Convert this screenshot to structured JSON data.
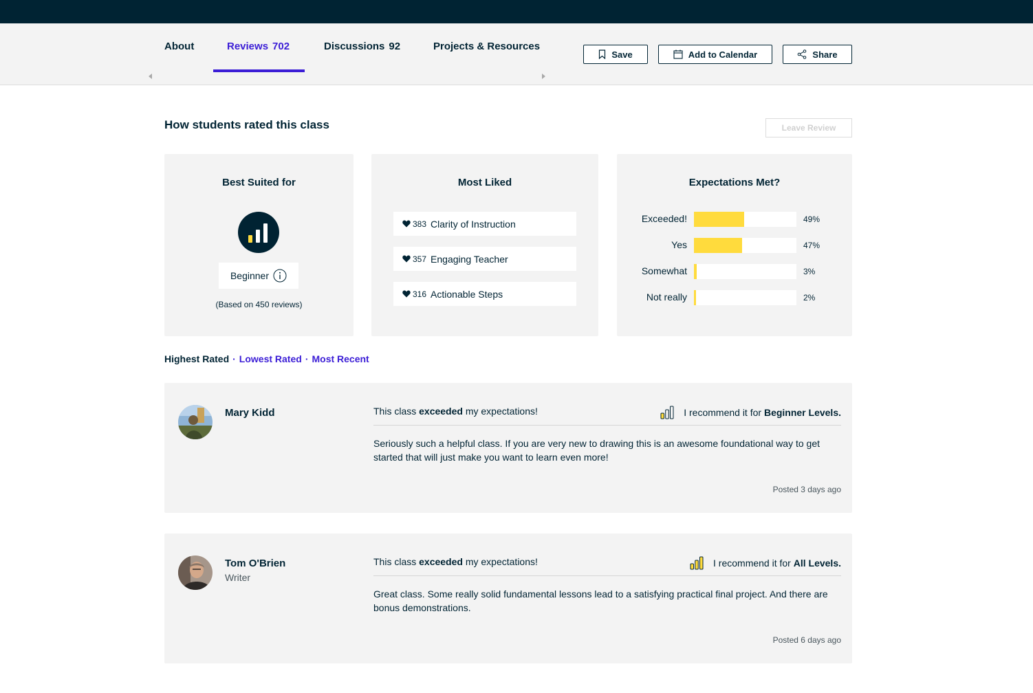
{
  "tabs": [
    {
      "label": "About",
      "count": ""
    },
    {
      "label": "Reviews",
      "count": "702"
    },
    {
      "label": "Discussions",
      "count": "92"
    },
    {
      "label": "Projects & Resources",
      "count": ""
    }
  ],
  "actions": {
    "save": "Save",
    "add_to_calendar": "Add to Calendar",
    "share": "Share"
  },
  "ratings": {
    "title": "How students rated this class",
    "leave_review": "Leave Review",
    "best_suited": {
      "title": "Best Suited for",
      "level": "Beginner",
      "based_on": "(Based on 450 reviews)"
    },
    "most_liked": {
      "title": "Most Liked",
      "items": [
        {
          "count": "383",
          "label": "Clarity of Instruction"
        },
        {
          "count": "357",
          "label": "Engaging Teacher"
        },
        {
          "count": "316",
          "label": "Actionable Steps"
        }
      ]
    },
    "expectations": {
      "title": "Expectations Met?",
      "rows": [
        {
          "label": "Exceeded!",
          "pct": "49%",
          "value": 49
        },
        {
          "label": "Yes",
          "pct": "47%",
          "value": 47
        },
        {
          "label": "Somewhat",
          "pct": "3%",
          "value": 3
        },
        {
          "label": "Not really",
          "pct": "2%",
          "value": 2
        }
      ]
    }
  },
  "sort": {
    "highest": "Highest Rated",
    "separator": "·",
    "lowest": "Lowest Rated",
    "recent": "Most Recent"
  },
  "reviews": [
    {
      "name": "Mary Kidd",
      "title": "",
      "exp_prefix": "This class",
      "exp_strong": "exceeded",
      "exp_suffix": "my expectations!",
      "rec_prefix": "I recommend it for",
      "rec_level": "Beginner Levels.",
      "body": "Seriously such a helpful class. If you are very new to drawing this is an awesome foundational way to get started that will just make you want to learn even more!",
      "posted": "Posted 3 days ago"
    },
    {
      "name": "Tom O'Brien",
      "title": "Writer",
      "exp_prefix": "This class",
      "exp_strong": "exceeded",
      "exp_suffix": "my expectations!",
      "rec_prefix": "I recommend it for",
      "rec_level": "All Levels.",
      "body": "Great class. Some really solid fundamental lessons lead to a satisfying practical final project. And there are bonus demonstrations.",
      "posted": "Posted 6 days ago"
    }
  ],
  "colors": {
    "navy": "#002333",
    "accent": "#3b1dd6",
    "yellow": "#ffdb3d",
    "card_bg": "#f3f3f3"
  }
}
